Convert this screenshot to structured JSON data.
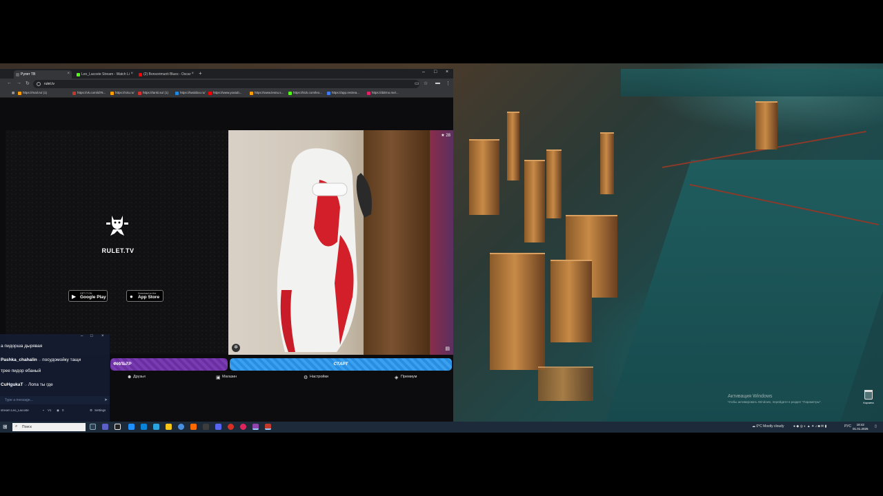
{
  "browser": {
    "tabs": [
      {
        "label": "Рулет ТВ",
        "active": true,
        "favicon_color": "#3a3a3a"
      },
      {
        "label": "Leo_Lacoste Stream - Watch Li",
        "active": false,
        "favicon_color": "#53fc18"
      },
      {
        "label": "(2) Bonsorimunti Blues - Oscar",
        "active": false,
        "favicon_color": "#ff0000"
      }
    ],
    "new_tab": "+",
    "address": "rulet.tv",
    "bookmarks": [
      {
        "label": "https://mail.ru/ (1)",
        "color": "#ff9e00"
      },
      {
        "label": "https://vk.com/id76...",
        "color": "#c0392b"
      },
      {
        "label": "https://rolu.ru/",
        "color": "#ff9e00"
      },
      {
        "label": "https://tanki.su/ (1)",
        "color": "#d9302c"
      },
      {
        "label": "https://kwiddoo.ru/",
        "color": "#1e88e5"
      },
      {
        "label": "https://www.youtub...",
        "color": "#ff0000"
      },
      {
        "label": "https://www.lesnu.s...",
        "color": "#ff9e00"
      },
      {
        "label": "https://kick.com/leo...",
        "color": "#53fc18"
      },
      {
        "label": "https://app.restrea...",
        "color": "#3d7cf5"
      },
      {
        "label": "https://ddrmo.me/...",
        "color": "#e91e63"
      }
    ]
  },
  "rulet": {
    "brand": "RULET.TV",
    "google_play_small": "GET IT ON",
    "google_play": "Google Play",
    "app_store_small": "Download on the",
    "app_store": "App Store",
    "viewer_count": "28",
    "filter_button": "ФИЛЬТР",
    "start_button": "СТАРТ",
    "nav": [
      {
        "label": "Друзья",
        "icon": "friends-icon",
        "glyph": "☻"
      },
      {
        "label": "Магазин",
        "icon": "shop-icon",
        "glyph": "▣"
      },
      {
        "label": "Настройки",
        "icon": "settings-icon",
        "glyph": "⚙"
      },
      {
        "label": "Премиум",
        "icon": "premium-icon",
        "glyph": "◈"
      }
    ],
    "colors": {
      "filter": "#7a3cb2",
      "start": "#3aa0f0"
    }
  },
  "chat": {
    "messages": [
      {
        "user": "",
        "text": "а пидорша дырявая"
      },
      {
        "user": "Pashka_chahalin",
        "text": "посудомойку тащи"
      },
      {
        "user": "",
        "text": "трее пидор ебаный"
      },
      {
        "user": "CuHgukaT",
        "text": "Лопа ты где"
      }
    ],
    "input_placeholder": "Type a message...",
    "channel": "stream Leo_Lacoste",
    "stat1": "V1",
    "stat2": "0",
    "settings": "Settings"
  },
  "desktop": {
    "recycle_bin": "Корзина",
    "activation_title": "Активация Windows",
    "activation_text": "Чтобы активировать Windows, перейдите в раздел \"Параметры\"."
  },
  "taskbar": {
    "search_placeholder": "Поиск",
    "weather": "0°C  Mostly cloudy",
    "lang": "РУС",
    "time": "18:42",
    "date": "01.01.2025"
  }
}
